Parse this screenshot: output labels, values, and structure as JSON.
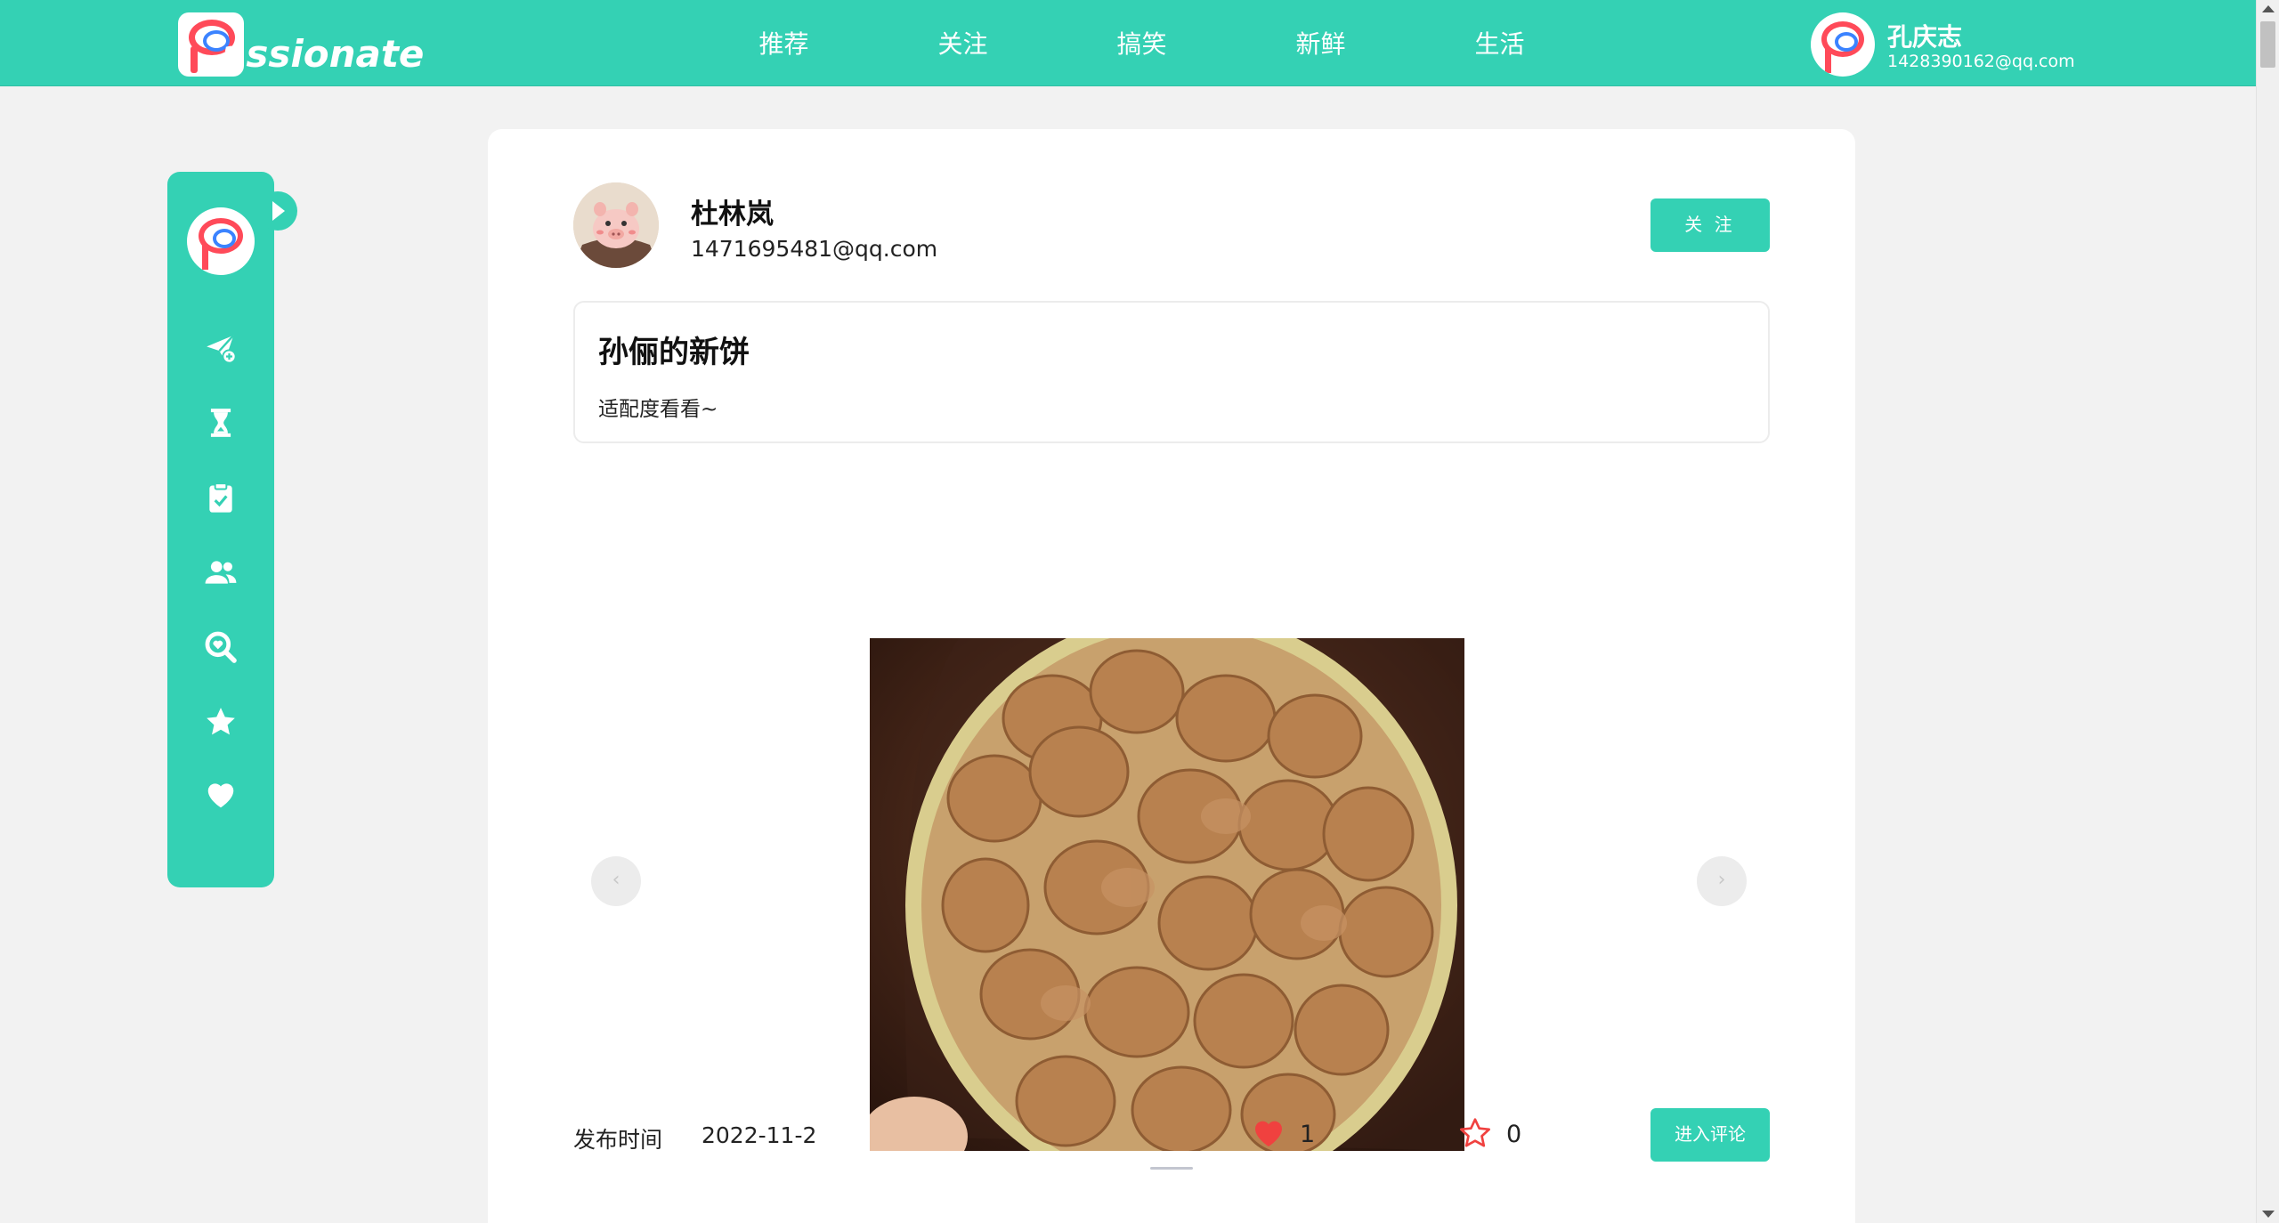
{
  "app": {
    "logo_text": "assionate",
    "accent_color": "#34d1b4"
  },
  "nav": {
    "items": [
      {
        "label": "推荐"
      },
      {
        "label": "关注"
      },
      {
        "label": "搞笑"
      },
      {
        "label": "新鲜"
      },
      {
        "label": "生活"
      }
    ]
  },
  "current_user": {
    "name": "孔庆志",
    "email": "1428390162@qq.com"
  },
  "sidebar": {
    "icons": [
      "send-plus-icon",
      "hourglass-icon",
      "clipboard-check-icon",
      "users-icon",
      "search-heart-icon",
      "star-icon",
      "heart-icon"
    ]
  },
  "post": {
    "author_name": "杜林岚",
    "author_email": "1471695481@qq.com",
    "follow_label": "关 注",
    "title": "孙俪的新饼",
    "description": "适配度看看~",
    "publish_label": "发布时间",
    "publish_date": "2022-11-2",
    "likes": "1",
    "favorites": "0",
    "comment_label": "进入评论",
    "carousel": {
      "prev_label": "‹",
      "next_label": "›"
    }
  }
}
